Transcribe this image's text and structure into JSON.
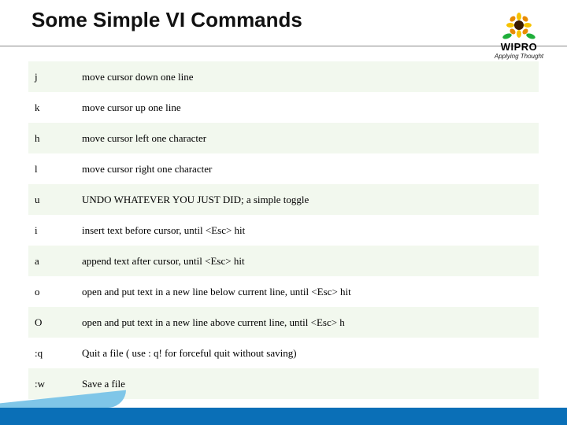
{
  "title": "Some Simple VI Commands",
  "logo": {
    "name": "WIPRO",
    "tagline": "Applying Thought"
  },
  "rows": [
    {
      "cmd": "j",
      "desc": "move cursor down one line"
    },
    {
      "cmd": "k",
      "desc": "move cursor up one line"
    },
    {
      "cmd": "h",
      "desc": "move cursor left one character"
    },
    {
      "cmd": "l",
      "desc": "move cursor right one character"
    },
    {
      "cmd": "u",
      "desc": "UNDO WHATEVER YOU JUST DID; a simple toggle"
    },
    {
      "cmd": "i",
      "desc": "insert text before cursor, until <Esc> hit"
    },
    {
      "cmd": "a",
      "desc": "append text after cursor, until <Esc> hit"
    },
    {
      "cmd": "o",
      "desc": "open and put text in a new line below current line, until <Esc> hit"
    },
    {
      "cmd": "O",
      "desc": "open and put text in a new line above current line, until <Esc> h"
    },
    {
      "cmd": ":q",
      "desc": "Quit a file ( use : q! for forceful quit without saving)"
    },
    {
      "cmd": ":w",
      "desc": "Save a file"
    }
  ]
}
